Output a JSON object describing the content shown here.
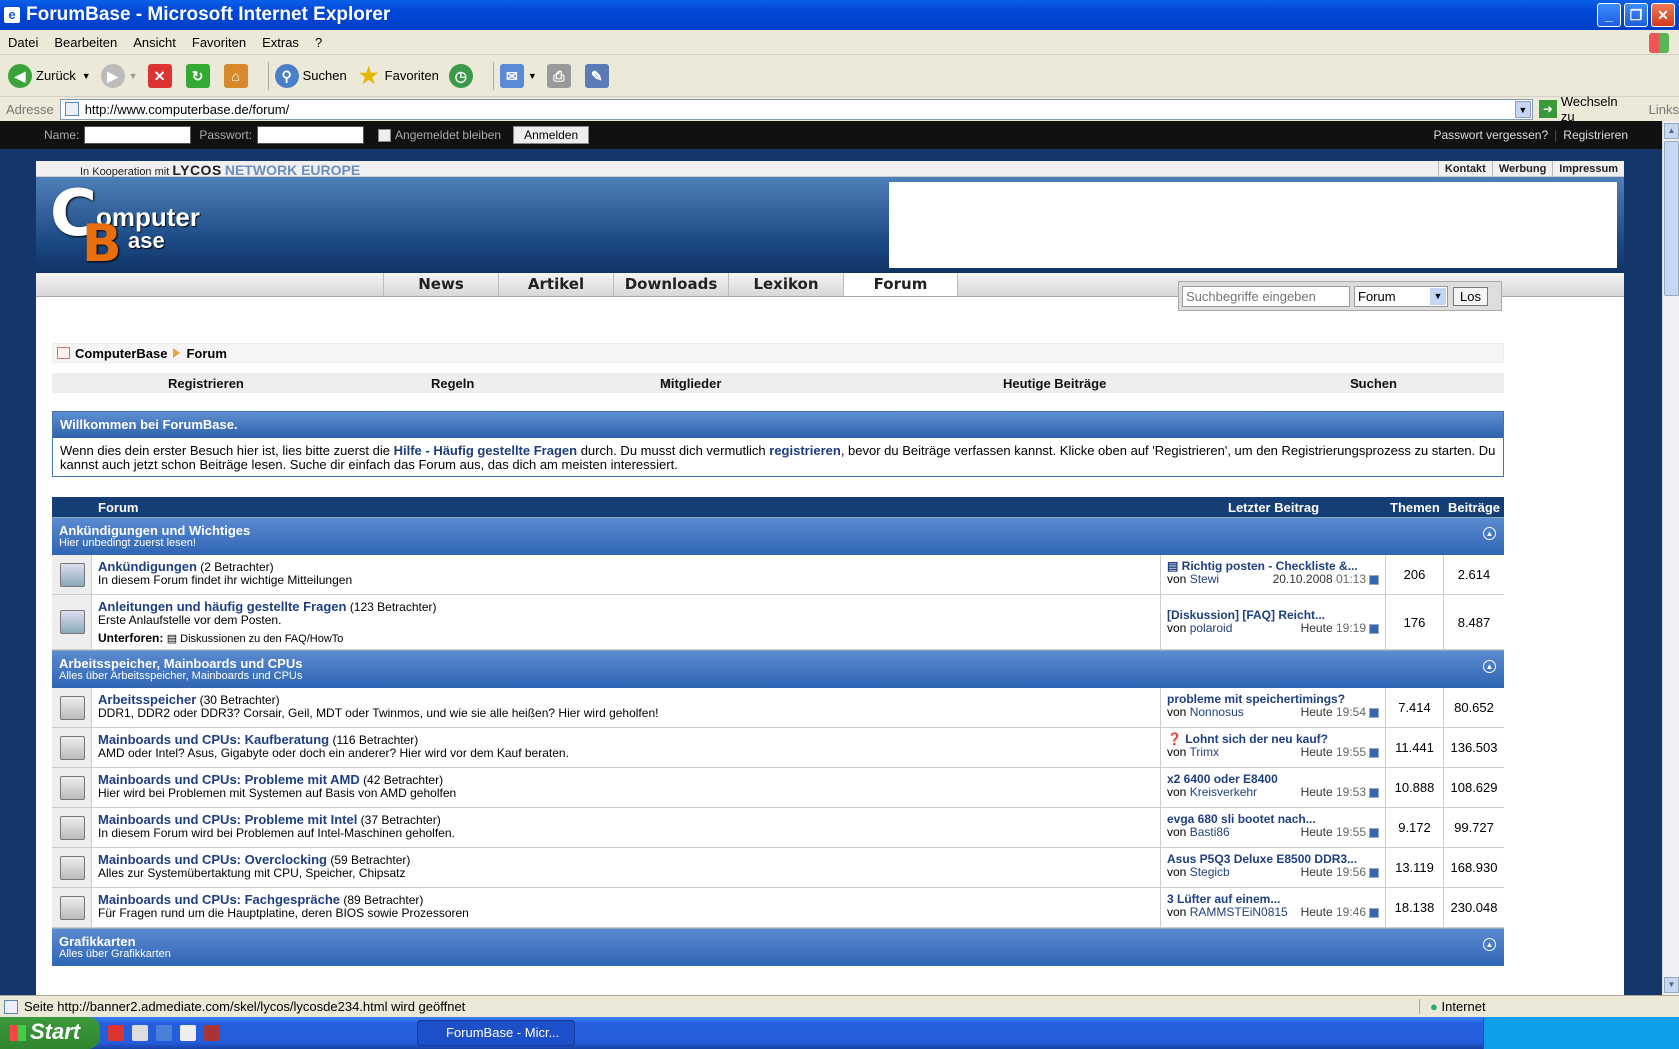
{
  "window": {
    "title": "ForumBase - Microsoft Internet Explorer",
    "min": "_",
    "max": "❐",
    "close": "✕"
  },
  "menu": [
    "Datei",
    "Bearbeiten",
    "Ansicht",
    "Favoriten",
    "Extras",
    "?"
  ],
  "toolbar": {
    "back": "Zurück",
    "search": "Suchen",
    "favorites": "Favoriten"
  },
  "address": {
    "label": "Adresse",
    "url": "http://www.computerbase.de/forum/",
    "go": "Wechseln zu",
    "links": "Links"
  },
  "login": {
    "name_label": "Name:",
    "password_label": "Passwort:",
    "remember": "Angemeldet bleiben",
    "button": "Anmelden",
    "forgot": "Passwort vergessen?",
    "register": "Registrieren"
  },
  "top": {
    "coop": "In Kooperation mit",
    "lycos": "LYCOS",
    "network": "NETWORK EUROPE",
    "links": [
      "Kontakt",
      "Werbung",
      "Impressum"
    ]
  },
  "logo": {
    "c": "C",
    "b": "B",
    "line1": "omputer",
    "line2": "ase"
  },
  "nav": {
    "tabs": [
      "News",
      "Artikel",
      "Downloads",
      "Lexikon",
      "Forum"
    ],
    "search_placeholder": "Suchbegriffe eingeben",
    "search_scope": "Forum",
    "search_button": "Los"
  },
  "breadcrumb": [
    "ComputerBase",
    "Forum"
  ],
  "subnav": [
    "Registrieren",
    "Regeln",
    "Mitglieder",
    "Heutige Beiträge",
    "Suchen"
  ],
  "welcome": {
    "title": "Willkommen bei ForumBase.",
    "p1": "Wenn dies dein erster Besuch hier ist, lies bitte zuerst die ",
    "link1": "Hilfe - Häufig gestellte Fragen",
    "p2": " durch. Du musst dich vermutlich ",
    "link2": "registrieren",
    "p3": ", bevor du Beiträge verfassen kannst. Klicke oben auf 'Registrieren', um den Registrierungsprozess zu starten. Du kannst auch jetzt schon Beiträge lesen. Suche dir einfach das Forum aus, das dich am meisten interessiert."
  },
  "table": {
    "headers": {
      "forum": "Forum",
      "last": "Letzter Beitrag",
      "topics": "Themen",
      "posts": "Beiträge"
    }
  },
  "categories": [
    {
      "name": "Ankündigungen und Wichtiges",
      "desc": "Hier unbedingt zuerst lesen!"
    },
    {
      "name": "Arbeitsspeicher, Mainboards und CPUs",
      "desc": "Alles über Arbeitsspeicher, Mainboards und CPUs"
    },
    {
      "name": "Grafikkarten",
      "desc": "Alles über Grafikkarten"
    }
  ],
  "forums": [
    {
      "title": "Ankündigungen",
      "viewers": "(2 Betrachter)",
      "desc": "In diesem Forum findet ihr wichtige Mitteilungen",
      "last_title": "Richtig posten - Checkliste &...",
      "by": "von",
      "user": "Stewi",
      "date": "20.10.2008",
      "time": "01:13",
      "topics": "206",
      "posts": "2.614"
    },
    {
      "title": "Anleitungen und häufig gestellte Fragen",
      "viewers": "(123 Betrachter)",
      "desc": "Erste Anlaufstelle vor dem Posten.",
      "sub_label": "Unterforen:",
      "sub": "Diskussionen zu den FAQ/HowTo",
      "last_title": "[Diskussion] [FAQ] Reicht...",
      "by": "von",
      "user": "polaroid",
      "date": "Heute",
      "time": "19:19",
      "topics": "176",
      "posts": "8.487"
    },
    {
      "title": "Arbeitsspeicher",
      "viewers": "(30 Betrachter)",
      "desc": "DDR1, DDR2 oder DDR3? Corsair, Geil, MDT oder Twinmos, und wie sie alle heißen? Hier wird geholfen!",
      "last_title": "probleme mit speichertimings?",
      "by": "von",
      "user": "Nonnosus",
      "date": "Heute",
      "time": "19:54",
      "topics": "7.414",
      "posts": "80.652"
    },
    {
      "title": "Mainboards und CPUs: Kaufberatung",
      "viewers": "(116 Betrachter)",
      "desc": "AMD oder Intel? Asus, Gigabyte oder doch ein anderer? Hier wird vor dem Kauf beraten.",
      "last_title": "Lohnt sich der neu kauf?",
      "by": "von",
      "user": "Trimx",
      "date": "Heute",
      "time": "19:55",
      "topics": "11.441",
      "posts": "136.503"
    },
    {
      "title": "Mainboards und CPUs: Probleme mit AMD",
      "viewers": "(42 Betrachter)",
      "desc": "Hier wird bei Problemen mit Systemen auf Basis von AMD geholfen",
      "last_title": "x2 6400 oder E8400",
      "by": "von",
      "user": "Kreisverkehr",
      "date": "Heute",
      "time": "19:53",
      "topics": "10.888",
      "posts": "108.629"
    },
    {
      "title": "Mainboards und CPUs: Probleme mit Intel",
      "viewers": "(37 Betrachter)",
      "desc": "In diesem Forum wird bei Problemen auf Intel-Maschinen geholfen.",
      "last_title": "evga 680 sli bootet nach...",
      "by": "von",
      "user": "Basti86",
      "date": "Heute",
      "time": "19:55",
      "topics": "9.172",
      "posts": "99.727"
    },
    {
      "title": "Mainboards und CPUs: Overclocking",
      "viewers": "(59 Betrachter)",
      "desc": "Alles zur Systemübertaktung mit CPU, Speicher, Chipsatz",
      "last_title": "Asus P5Q3 Deluxe E8500 DDR3...",
      "by": "von",
      "user": "Stegicb",
      "date": "Heute",
      "time": "19:56",
      "topics": "13.119",
      "posts": "168.930"
    },
    {
      "title": "Mainboards und CPUs: Fachgespräche",
      "viewers": "(89 Betrachter)",
      "desc": "Für Fragen rund um die Hauptplatine, deren BIOS sowie Prozessoren",
      "last_title": "3 Lüfter auf einem...",
      "by": "von",
      "user": "RAMMSTEiN0815",
      "date": "Heute",
      "time": "19:46",
      "topics": "18.138",
      "posts": "230.048"
    }
  ],
  "status": {
    "text": "Seite http://banner2.admediate.com/skel/lycos/lycosde234.html wird geöffnet",
    "zone": "Internet"
  },
  "taskbar": {
    "start": "Start",
    "item": "ForumBase - Micr..."
  }
}
